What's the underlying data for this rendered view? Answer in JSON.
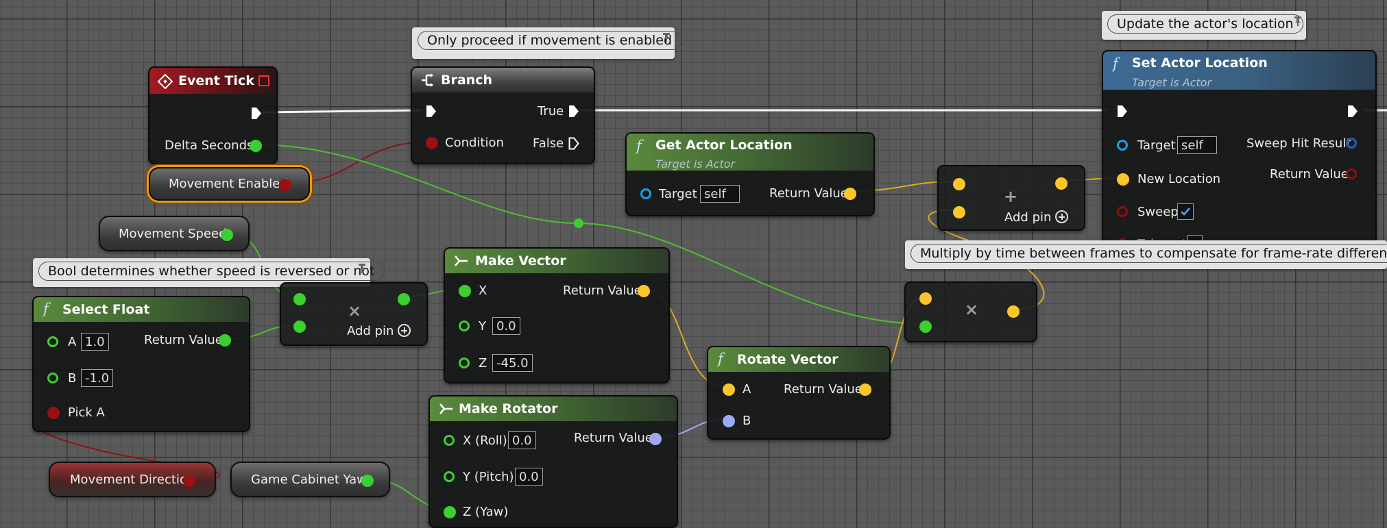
{
  "colors": {
    "exec": "#ffffff",
    "float": "#3ad12e",
    "bool": "#8e0f0f",
    "vector": "#fcc62b",
    "rotator": "#9ea9f4",
    "object": "#1f9de4",
    "selection": "#e8981f"
  },
  "comments": {
    "branch": "Only proceed if movement is enabled",
    "set_location": "Update the actor's location",
    "multiply": "Multiply by time between frames to compensate for frame-rate differences",
    "select_float": "Bool determines whether speed is reversed or not"
  },
  "nodes": {
    "event_tick": {
      "title": "Event Tick",
      "icon": "event-diamond-icon",
      "delta_seconds": "Delta Seconds"
    },
    "branch": {
      "title": "Branch",
      "icon": "branch-icon",
      "condition": "Condition",
      "true_label": "True",
      "false_label": "False"
    },
    "get_actor_location": {
      "title": "Get Actor Location",
      "subtitle": "Target is Actor",
      "target": "Target",
      "target_value": "self",
      "return_value": "Return Value"
    },
    "set_actor_location": {
      "title": "Set Actor Location",
      "subtitle": "Target is Actor",
      "target": "Target",
      "target_value": "self",
      "new_location": "New Location",
      "sweep": "Sweep",
      "sweep_checked": true,
      "teleport": "Teleport",
      "sweep_hit_result": "Sweep Hit Result",
      "return_value": "Return Value"
    },
    "add_vector": {
      "add_pin": "Add pin"
    },
    "multiply_float": {
      "add_pin": "Add pin"
    },
    "multiply_vector": {},
    "make_vector": {
      "title": "Make Vector",
      "x": "X",
      "y": "Y",
      "y_value": "0.0",
      "z": "Z",
      "z_value": "-45.0",
      "return_value": "Return Value"
    },
    "rotate_vector": {
      "title": "Rotate Vector",
      "a": "A",
      "b": "B",
      "return_value": "Return Value"
    },
    "make_rotator": {
      "title": "Make Rotator",
      "x": "X (Roll)",
      "x_value": "0.0",
      "y": "Y (Pitch)",
      "y_value": "0.0",
      "z": "Z (Yaw)",
      "return_value": "Return Value"
    },
    "select_float": {
      "title": "Select Float",
      "a": "A",
      "a_value": "1.0",
      "b": "B",
      "b_value": "-1.0",
      "pick_a": "Pick A",
      "return_value": "Return Value"
    }
  },
  "variables": {
    "movement_enabled": "Movement Enabled",
    "movement_speed": "Movement Speed",
    "movement_direction": "Movement Direction",
    "game_cabinet_yaw": "Game Cabinet Yaw"
  }
}
